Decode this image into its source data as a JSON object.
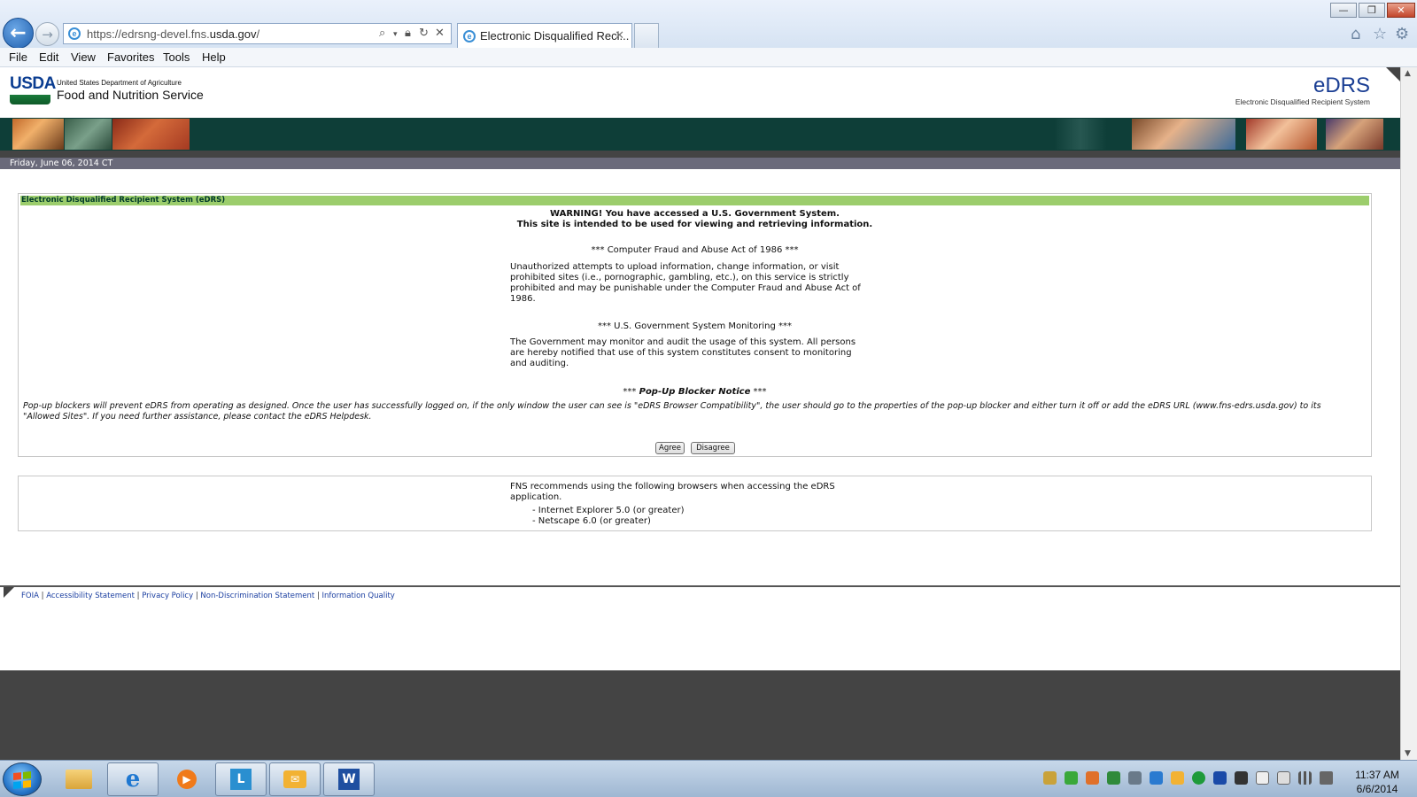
{
  "browser": {
    "url_prefix": "https://edrsng-devel.fns.",
    "url_domain": "usda.gov",
    "url_suffix": "/",
    "tab_title": "Electronic Disqualified Reci...",
    "tab_close": "✕",
    "menu": [
      "File",
      "Edit",
      "View",
      "Favorites",
      "Tools",
      "Help"
    ],
    "window_controls": {
      "minimize": "—",
      "restore": "❐",
      "close": "✕"
    }
  },
  "header": {
    "usda_mark": "USDA",
    "department": "United States Department of Agriculture",
    "agency": "Food and Nutrition Service",
    "app_logo": "eDRS",
    "app_full_name": "Electronic Disqualified Recipient System"
  },
  "date_bar": "Friday, June 06, 2014 CT",
  "notice": {
    "heading": "Electronic Disqualified Recipient System (eDRS)",
    "warning_line1": "WARNING! You have accessed a U.S. Government System.",
    "warning_line2": "This site is intended to be used for viewing and retrieving information.",
    "act_title": "*** Computer Fraud and Abuse Act of 1986 ***",
    "act_text": "Unauthorized attempts to upload information, change information, or visit prohibited sites (i.e., pornographic, gambling, etc.), on this service is strictly prohibited and may be punishable under the Computer Fraud and Abuse Act of 1986.",
    "monitoring_title": "*** U.S. Government System Monitoring ***",
    "monitoring_text": "The Government may monitor and audit the usage of this system. All persons are hereby notified that use of this system constitutes consent to monitoring and auditing.",
    "popup_stars_left": "*** ",
    "popup_title": "Pop-Up Blocker Notice",
    "popup_stars_right": " ***",
    "popup_text": "Pop-up blockers will prevent eDRS from operating as designed. Once the user has successfully logged on, if the only window the user can see is \"eDRS Browser Compatibility\", the user should go to the properties of the pop-up blocker and either turn it off or add the eDRS URL (www.fns-edrs.usda.gov) to its \"Allowed Sites\". If you need further assistance, please contact the eDRS Helpdesk.",
    "agree_label": "Agree",
    "disagree_label": "Disagree"
  },
  "browsers_box": {
    "intro": "FNS recommends using the following browsers when accessing the eDRS application.",
    "items": [
      "- Internet Explorer 5.0 (or greater)",
      "- Netscape 6.0 (or greater)"
    ]
  },
  "footer": {
    "links": [
      "FOIA",
      "Accessibility Statement",
      "Privacy Policy",
      "Non-Discrimination Statement",
      "Information Quality"
    ],
    "separator": " | "
  },
  "taskbar": {
    "apps": [
      "file-explorer-icon",
      "internet-explorer-icon",
      "media-player-icon",
      "lync-icon",
      "outlook-icon",
      "word-icon"
    ],
    "time": "11:37 AM",
    "date": "6/6/2014"
  },
  "colors": {
    "banner": "#0e3e38",
    "notice_header": "#9ccd6c",
    "date_bar": "#6a6a7a",
    "link": "#1a3ea0",
    "edrs_logo": "#1a3e93"
  }
}
